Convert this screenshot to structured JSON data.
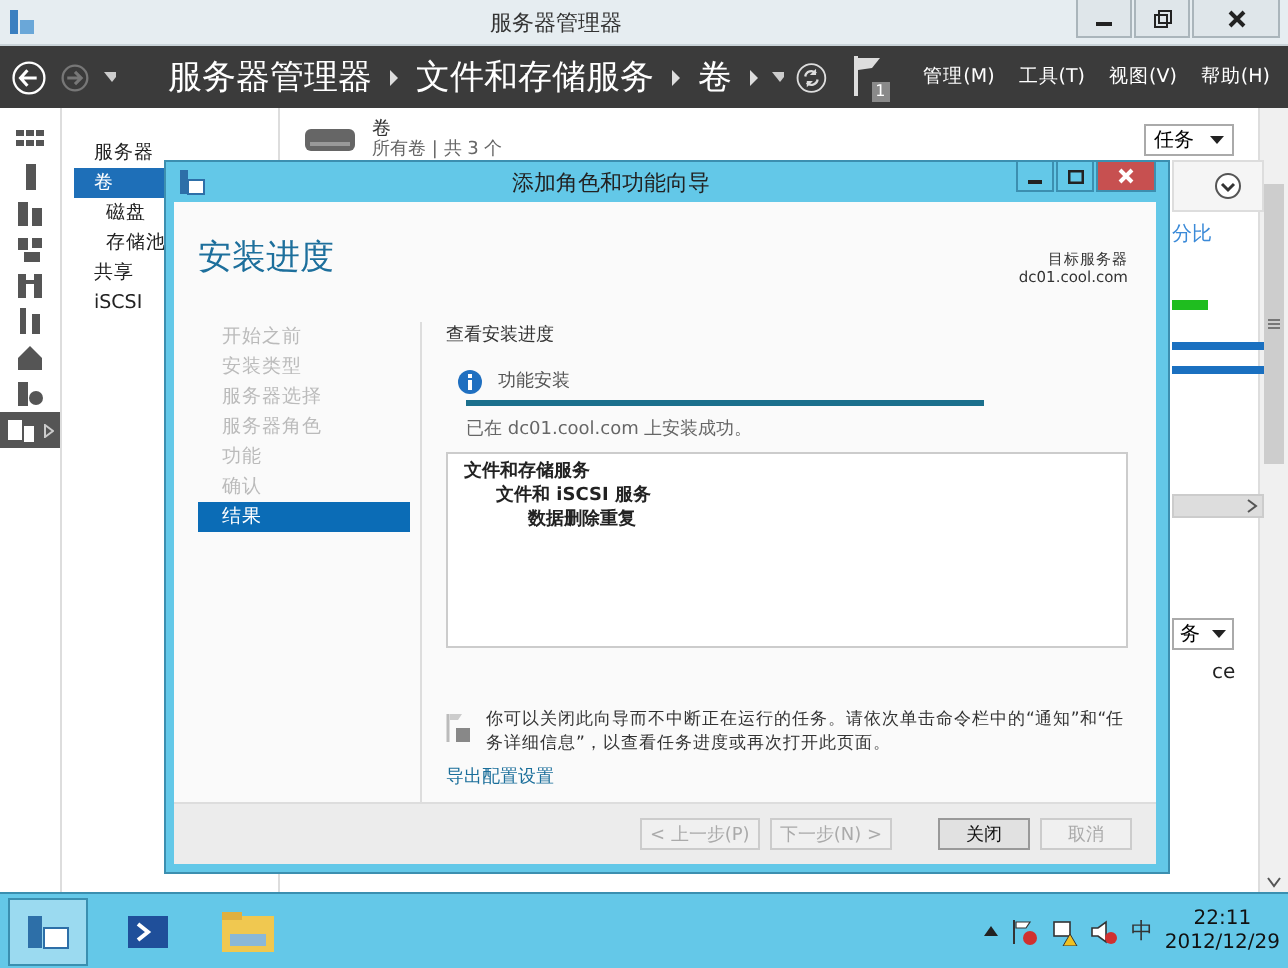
{
  "window": {
    "title": "服务器管理器"
  },
  "header": {
    "breadcrumb": [
      "服务器管理器",
      "文件和存储服务",
      "卷"
    ],
    "notifications": "1",
    "menus": [
      "管理(M)",
      "工具(T)",
      "视图(V)",
      "帮助(H)"
    ]
  },
  "rail": [
    {
      "selected": false
    },
    {
      "selected": false
    },
    {
      "selected": false
    },
    {
      "selected": false
    },
    {
      "selected": false
    },
    {
      "selected": false
    },
    {
      "selected": false
    },
    {
      "selected": false
    },
    {
      "selected": true
    }
  ],
  "nav": [
    {
      "label": "服务器",
      "selected": false
    },
    {
      "label": "卷",
      "selected": true,
      "children": [
        {
          "label": "磁盘",
          "selected": false
        },
        {
          "label": "存储池",
          "selected": false
        }
      ]
    },
    {
      "label": "共享",
      "selected": false
    },
    {
      "label": "iSCSI",
      "selected": false
    }
  ],
  "volumes": {
    "title": "卷",
    "subtitle": "所有卷 | 共 3 个",
    "tasks": "任务"
  },
  "background": {
    "column_header": "分比",
    "tasks": "务",
    "text": "ce"
  },
  "dialog": {
    "title": "添加角色和功能向导",
    "heading": "安装进度",
    "target_label": "目标服务器",
    "target": "dc01.cool.com",
    "steps": [
      {
        "label": "开始之前",
        "selected": false
      },
      {
        "label": "安装类型",
        "selected": false
      },
      {
        "label": "服务器选择",
        "selected": false
      },
      {
        "label": "服务器角色",
        "selected": false
      },
      {
        "label": "功能",
        "selected": false
      },
      {
        "label": "确认",
        "selected": false
      },
      {
        "label": "结果",
        "selected": true
      }
    ],
    "section": "查看安装进度",
    "status": "功能安装",
    "progress": {
      "level": 1
    },
    "result": "已在 dc01.cool.com 上安装成功。",
    "results": [
      {
        "label": "文件和存储服务",
        "children": [
          {
            "label": "文件和 iSCSI 服务",
            "children": [
              {
                "label": "数据删除重复"
              }
            ]
          }
        ]
      }
    ],
    "note": "你可以关闭此向导而不中断正在运行的任务。请依次单击命令栏中的“通知”和“任务详细信息”，以查看任务进度或再次打开此页面。",
    "export_link": "导出配置设置",
    "buttons": [
      {
        "label": "< 上一步(P)",
        "disabled": true
      },
      {
        "label": "下一步(N) >",
        "disabled": true
      },
      {
        "label": "关闭",
        "disabled": false
      },
      {
        "label": "取消",
        "disabled": true
      }
    ]
  },
  "taskbar": {
    "apps": [
      {
        "selected": true
      },
      {
        "selected": false
      },
      {
        "selected": false
      }
    ],
    "ime": "中",
    "time": "22:11",
    "date": "2012/12/29"
  }
}
